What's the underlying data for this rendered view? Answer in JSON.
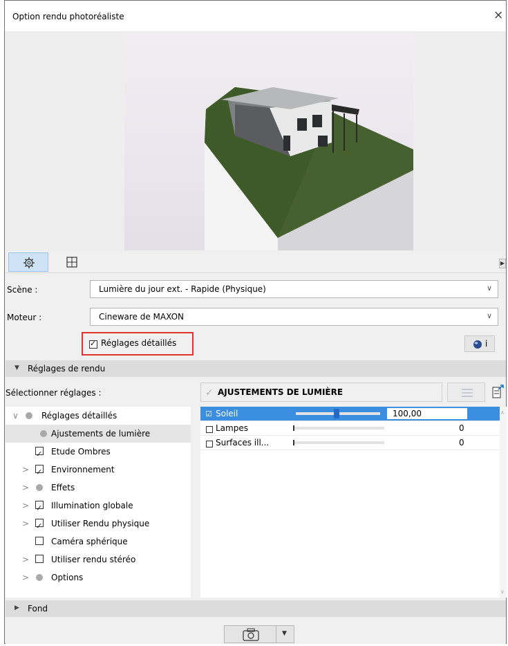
{
  "window": {
    "title": "Option rendu photoréaliste",
    "close_glyph": "×"
  },
  "tabs": [
    {
      "name": "settings",
      "icon": "gear-icon"
    },
    {
      "name": "size",
      "icon": "resize-frame-icon"
    }
  ],
  "tab_scroll_glyph": "▶",
  "scene": {
    "label": "Scène :",
    "value": "Lumière du jour ext. - Rapide (Physique)"
  },
  "engine": {
    "label": "Moteur :",
    "value": "Cineware de MAXON"
  },
  "detailed_settings": {
    "label": "Réglages détaillés",
    "checked": true
  },
  "info_button": {
    "glyph": "i",
    "icon": "material-sphere-icon"
  },
  "render_settings_section": {
    "label": "Réglages de rendu",
    "expanded": true
  },
  "select_settings_label": "Sélectionner réglages :",
  "tree": [
    {
      "label": "Réglages détaillés",
      "expander": "∨",
      "kind": "dot",
      "indent": 0
    },
    {
      "label": "Ajustements de lumière",
      "expander": "",
      "kind": "dot",
      "indent": 1,
      "selected": true
    },
    {
      "label": "Etude Ombres",
      "expander": "",
      "kind": "checkbox",
      "checked": true,
      "indent": 1
    },
    {
      "label": "Environnement",
      "expander": ">",
      "kind": "checkbox",
      "checked": true,
      "indent": 1
    },
    {
      "label": "Effets",
      "expander": ">",
      "kind": "dot",
      "indent": 1
    },
    {
      "label": "Illumination globale",
      "expander": ">",
      "kind": "checkbox",
      "checked": true,
      "indent": 1
    },
    {
      "label": "Utiliser Rendu physique",
      "expander": ">",
      "kind": "checkbox",
      "checked": true,
      "indent": 1
    },
    {
      "label": "Caméra sphérique",
      "expander": "",
      "kind": "checkbox",
      "checked": false,
      "indent": 1
    },
    {
      "label": "Utiliser rendu stéréo",
      "expander": ">",
      "kind": "checkbox",
      "checked": false,
      "indent": 1
    },
    {
      "label": "Options",
      "expander": ">",
      "kind": "dot",
      "indent": 1
    }
  ],
  "panel_header": {
    "label": "AJUSTEMENTS DE LUMIÈRE",
    "checked": true
  },
  "lights": [
    {
      "label": "Soleil",
      "checked": true,
      "value": "100,00",
      "level": 0.48,
      "selected": true
    },
    {
      "label": "Lampes",
      "checked": false,
      "value": "0",
      "level": 0.0
    },
    {
      "label": "Surfaces ill...",
      "checked": false,
      "value": "0",
      "level": 0.0
    }
  ],
  "background_section": {
    "label": "Fond",
    "expanded": false
  },
  "colors": {
    "accent": "#3b8de0",
    "highlight_border": "#e0312b"
  }
}
